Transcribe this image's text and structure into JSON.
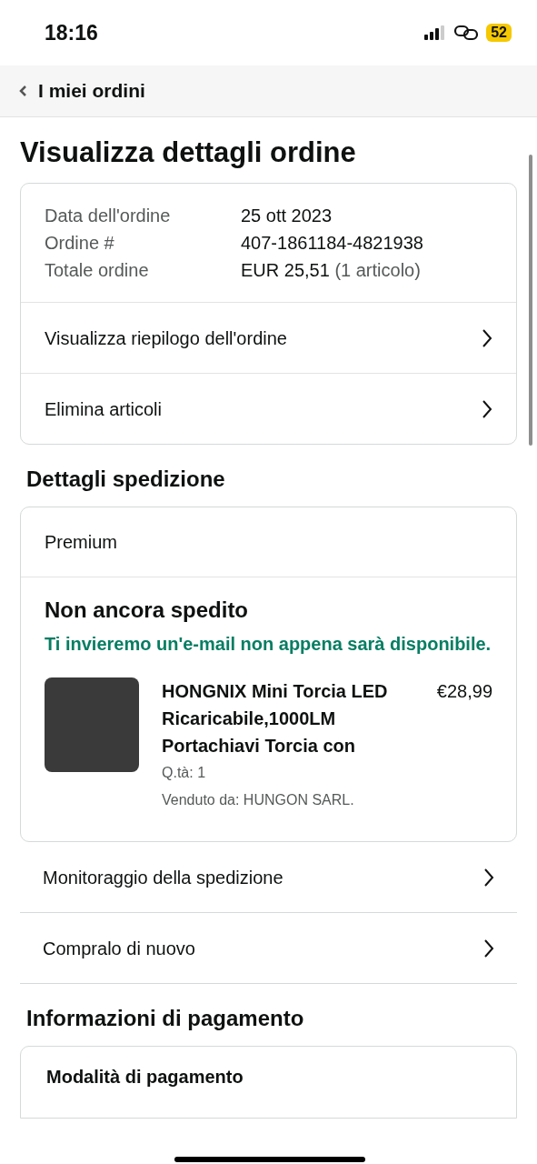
{
  "status_bar": {
    "time": "18:16",
    "battery": "52"
  },
  "nav": {
    "back_label": "I miei ordini"
  },
  "title": "Visualizza dettagli ordine",
  "order_summary": {
    "fields": [
      {
        "label": "Data dell'ordine",
        "value": "25 ott 2023"
      },
      {
        "label": "Ordine #",
        "value": "407-1861184-4821938"
      },
      {
        "label": "Totale ordine",
        "value": "EUR 25,51",
        "note": "(1 articolo)"
      }
    ],
    "links": [
      "Visualizza riepilogo dell'ordine",
      "Elimina articoli"
    ]
  },
  "shipping": {
    "heading": "Dettagli spedizione",
    "service": "Premium",
    "status": "Non ancora spedito",
    "message": "Ti invieremo un'e-mail non appena sarà disponibile.",
    "item": {
      "title": "HONGNIX Mini Torcia LED Ricaricabile,1000LM Portachiavi Torcia con",
      "price": "€28,99",
      "quantity": "Q.tà: 1",
      "seller": "Venduto da: HUNGON SARL."
    },
    "links": [
      "Monitoraggio della spedizione",
      "Compralo di nuovo"
    ]
  },
  "payment": {
    "heading": "Informazioni di pagamento",
    "method_heading": "Modalità di pagamento"
  }
}
